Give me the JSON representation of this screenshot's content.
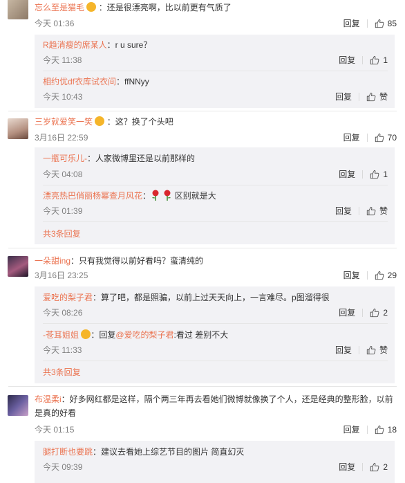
{
  "comments": [
    {
      "user": "忘么至是猫毛",
      "text": "：还是很漂亮啊，比以前更有气质了",
      "time": "今天 01:36",
      "reply_label": "回复",
      "likes": "85",
      "replies": [
        {
          "user": "R趋消瘦的席某人",
          "text": "：r u sure？",
          "time": "今天 11:38",
          "reply_label": "回复",
          "likes": "1"
        },
        {
          "user": "相约优df衣库试衣间",
          "text": "：ffNNyy",
          "time": "今天 10:43",
          "reply_label": "回复",
          "likes": "赞"
        }
      ]
    },
    {
      "user": "三岁就爱笑一笑",
      "text": "：这？换了个头吧",
      "time": "3月16日 22:59",
      "reply_label": "回复",
      "likes": "70",
      "replies": [
        {
          "user": "一瓶可乐儿-",
          "text": "：人家微博里还是以前那样的",
          "time": "今天 04:08",
          "reply_label": "回复",
          "likes": "1"
        },
        {
          "user": "漂亮热巴俏丽杨幂查月风花",
          "text": "区别就是大",
          "time": "今天 01:39",
          "reply_label": "回复",
          "likes": "赞"
        }
      ],
      "more": "共3条回复"
    },
    {
      "user": "一朵甜ing",
      "text": "：只有我觉得以前好看吗？蛮清纯的",
      "time": "3月16日 23:25",
      "reply_label": "回复",
      "likes": "29",
      "replies": [
        {
          "user": "爱吃的梨子君",
          "text": "：算了吧，都是照骗，以前上过天天向上，一言难尽。p图溜得很",
          "time": "今天 08:26",
          "reply_label": "回复",
          "likes": "2"
        },
        {
          "user": "-苍耳姐姐",
          "text_pre": "：回复",
          "mention": "@爱吃的梨子君",
          "text": ":看过 差别不大",
          "time": "今天 11:33",
          "reply_label": "回复",
          "likes": "赞"
        }
      ],
      "more": "共3条回复"
    },
    {
      "user": "布温柔i",
      "text": "：好多网红都是这样，隔个两三年再去看她们微博就像换了个人，还是经典的整形脸，以前",
      "text2": "是真的好看",
      "time": "今天 01:15",
      "reply_label": "回复",
      "likes": "18",
      "replies": [
        {
          "user": "腿打断也要跳",
          "text": "：建议去看她上综艺节目的图片   简直幻灭",
          "time": "今天 09:39",
          "reply_label": "回复",
          "likes": "2"
        }
      ]
    }
  ],
  "icons": {
    "like": "thumbs-up-icon",
    "emoji": "smiley-emoji-icon",
    "rose": "rose-icon"
  },
  "colors": {
    "username": "#eb7350",
    "reply_bg": "#f2f2f5",
    "meta": "#808080"
  }
}
